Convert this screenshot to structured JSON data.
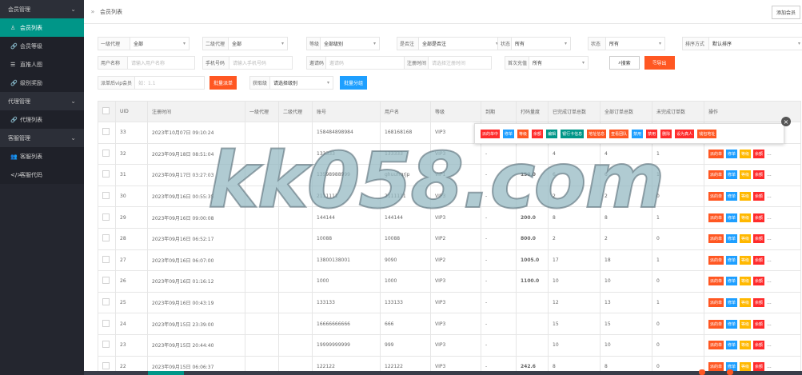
{
  "sidebar": {
    "groups": [
      {
        "label": "会员管理",
        "items": [
          {
            "label": "会员列表",
            "icon": "user-icon",
            "active": true
          },
          {
            "label": "会员等级",
            "icon": "link-icon"
          },
          {
            "label": "直推人图",
            "icon": "list-icon"
          },
          {
            "label": "级别奖励",
            "icon": "link-icon"
          }
        ]
      },
      {
        "label": "代理管理",
        "items": [
          {
            "label": "代理列表",
            "icon": "link-icon"
          }
        ]
      },
      {
        "label": "客服管理",
        "items": [
          {
            "label": "客服列表",
            "icon": "users-icon"
          },
          {
            "label": "客服代码",
            "icon": "code-icon"
          }
        ]
      }
    ]
  },
  "tabbar": {
    "current": "会员列表",
    "right_button": "添加会员"
  },
  "filters": {
    "row1": [
      {
        "label": "一级代理",
        "value": "全部"
      },
      {
        "label": "二级代理",
        "value": "全部"
      },
      {
        "label": "等级",
        "value": "全部级别"
      },
      {
        "label": "是否注",
        "value": "全部是否注"
      },
      {
        "label": "状态",
        "value": "所有"
      },
      {
        "label": "状态",
        "value": "所有"
      },
      {
        "label": "排序方式",
        "value": "默认排序"
      }
    ],
    "row2": [
      {
        "label": "用户名称",
        "placeholder": "请输入用户名称"
      },
      {
        "label": "手机号码",
        "placeholder": "请输入手机号码"
      },
      {
        "label": "邀请码",
        "placeholder": "邀请码"
      },
      {
        "label": "注册时间",
        "placeholder": "请选择注册时间"
      },
      {
        "label": "首次充值",
        "value": "所有"
      }
    ],
    "search_button": "搜索",
    "export_button": "导出",
    "row3": {
      "label1": "派单后vip会员",
      "placeholder1": "如：1.1",
      "btn1": "批量派单",
      "label2": "获取级",
      "value2": "请选择级别",
      "btn2": "批量分组"
    }
  },
  "table": {
    "headers": [
      "UID",
      "注册时间",
      "一级代理",
      "二级代理",
      "账号",
      "用户名",
      "等级",
      "到期",
      "打码量度",
      "已完成订单总数",
      "全部订单总数",
      "未完成订单数",
      "操作"
    ],
    "rows": [
      {
        "uid": "33",
        "time": "2023年10月07日 09:10:24",
        "a1": "",
        "a2": "",
        "acct": "158484898984",
        "user": "168168168",
        "lvl": "VIP3",
        "exp": "-",
        "amt": "",
        "done": "",
        "total": "",
        "undone": ""
      },
      {
        "uid": "32",
        "time": "2023年09月18日 08:51:04",
        "a1": "",
        "a2": "",
        "acct": "133333",
        "user": "133333",
        "lvl": "VIP3",
        "exp": "-",
        "amt": "",
        "done": "4",
        "total": "4",
        "undone": "1"
      },
      {
        "uid": "31",
        "time": "2023年09月17日 03:27:03",
        "a1": "",
        "a2": "",
        "acct": "13598988999",
        "user": "ghuufrqrjp",
        "lvl": "VIP1",
        "exp": "-",
        "amt": "150.0",
        "done": "6",
        "total": "6",
        "undone": "1"
      },
      {
        "uid": "30",
        "time": "2023年09月16日 00:55:35",
        "a1": "",
        "a2": "",
        "acct": "2111111",
        "user": "2111111",
        "lvl": "VIP3",
        "exp": "-",
        "amt": "",
        "done": "2",
        "total": "2",
        "undone": "0"
      },
      {
        "uid": "29",
        "time": "2023年09月16日 09:00:08",
        "a1": "",
        "a2": "",
        "acct": "144144",
        "user": "144144",
        "lvl": "VIP3",
        "exp": "-",
        "amt": "200.0",
        "done": "8",
        "total": "8",
        "undone": "1"
      },
      {
        "uid": "28",
        "time": "2023年09月16日 06:52:17",
        "a1": "",
        "a2": "",
        "acct": "10088",
        "user": "10088",
        "lvl": "VIP2",
        "exp": "-",
        "amt": "800.0",
        "done": "2",
        "total": "2",
        "undone": "0"
      },
      {
        "uid": "27",
        "time": "2023年09月16日 06:07:00",
        "a1": "",
        "a2": "",
        "acct": "13800138001",
        "user": "9090",
        "lvl": "VIP2",
        "exp": "-",
        "amt": "1005.0",
        "done": "17",
        "total": "18",
        "undone": "1"
      },
      {
        "uid": "26",
        "time": "2023年09月16日 01:16:12",
        "a1": "",
        "a2": "",
        "acct": "1000",
        "user": "1000",
        "lvl": "VIP3",
        "exp": "-",
        "amt": "1100.0",
        "done": "10",
        "total": "10",
        "undone": "0"
      },
      {
        "uid": "25",
        "time": "2023年09月16日 00:43:19",
        "a1": "",
        "a2": "",
        "acct": "133133",
        "user": "133133",
        "lvl": "VIP3",
        "exp": "-",
        "amt": "",
        "done": "12",
        "total": "13",
        "undone": "1"
      },
      {
        "uid": "24",
        "time": "2023年09月15日 23:39:00",
        "a1": "",
        "a2": "",
        "acct": "16666666666",
        "user": "666",
        "lvl": "VIP3",
        "exp": "-",
        "amt": "",
        "done": "15",
        "total": "15",
        "undone": "0"
      },
      {
        "uid": "23",
        "time": "2023年09月15日 20:44:40",
        "a1": "",
        "a2": "",
        "acct": "19999999999",
        "user": "999",
        "lvl": "VIP3",
        "exp": "-",
        "amt": "",
        "done": "10",
        "total": "10",
        "undone": "0"
      },
      {
        "uid": "22",
        "time": "2023年09月15日 06:06:37",
        "a1": "",
        "a2": "",
        "acct": "122122",
        "user": "122122",
        "lvl": "VIP3",
        "exp": "-",
        "amt": "242.6",
        "done": "8",
        "total": "8",
        "undone": "0"
      }
    ],
    "ops": [
      "派的单",
      "修单",
      "等级",
      "余额"
    ],
    "more": "..."
  },
  "popup": {
    "buttons": [
      {
        "label": "派的单中",
        "color": "#ff2b2b"
      },
      {
        "label": "修单",
        "color": "#1e9fff"
      },
      {
        "label": "等级",
        "color": "#ff5722"
      },
      {
        "label": "余额",
        "color": "#ff2b2b"
      },
      {
        "label": "编辑",
        "color": "#009688"
      },
      {
        "label": "银行卡信息",
        "color": "#009688"
      },
      {
        "label": "地址信息",
        "color": "#ff5722"
      },
      {
        "label": "查看团队",
        "color": "#ff5722"
      },
      {
        "label": "禁用",
        "color": "#1e9fff"
      },
      {
        "label": "禁用",
        "color": "#ff2b2b"
      },
      {
        "label": "删除",
        "color": "#ff2b2b"
      },
      {
        "label": "设为真人",
        "color": "#ff2b2b"
      },
      {
        "label": "钱包地址",
        "color": "#ff5722"
      }
    ]
  },
  "watermark": "kk058.com"
}
